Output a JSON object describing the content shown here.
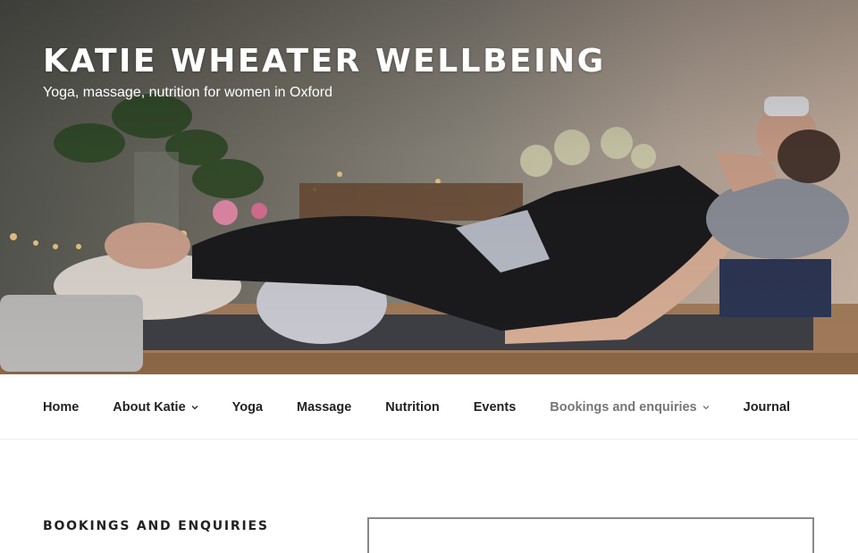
{
  "site": {
    "title": "KATIE WHEATER WELLBEING",
    "tagline": "Yoga, massage, nutrition for women in Oxford"
  },
  "hero": {
    "image": "yoga-restorative-pose-photo"
  },
  "nav": {
    "items": [
      {
        "label": "Home",
        "has_dropdown": false
      },
      {
        "label": "About Katie",
        "has_dropdown": true
      },
      {
        "label": "Yoga",
        "has_dropdown": false
      },
      {
        "label": "Massage",
        "has_dropdown": false
      },
      {
        "label": "Nutrition",
        "has_dropdown": false
      },
      {
        "label": "Events",
        "has_dropdown": false
      },
      {
        "label": "Bookings and enquiries",
        "has_dropdown": true,
        "current": true
      },
      {
        "label": "Journal",
        "has_dropdown": false
      }
    ]
  },
  "main": {
    "heading": "BOOKINGS AND ENQUIRIES"
  },
  "colors": {
    "nav_text": "#222222",
    "nav_current": "#767676",
    "title_text": "#ffffff"
  }
}
